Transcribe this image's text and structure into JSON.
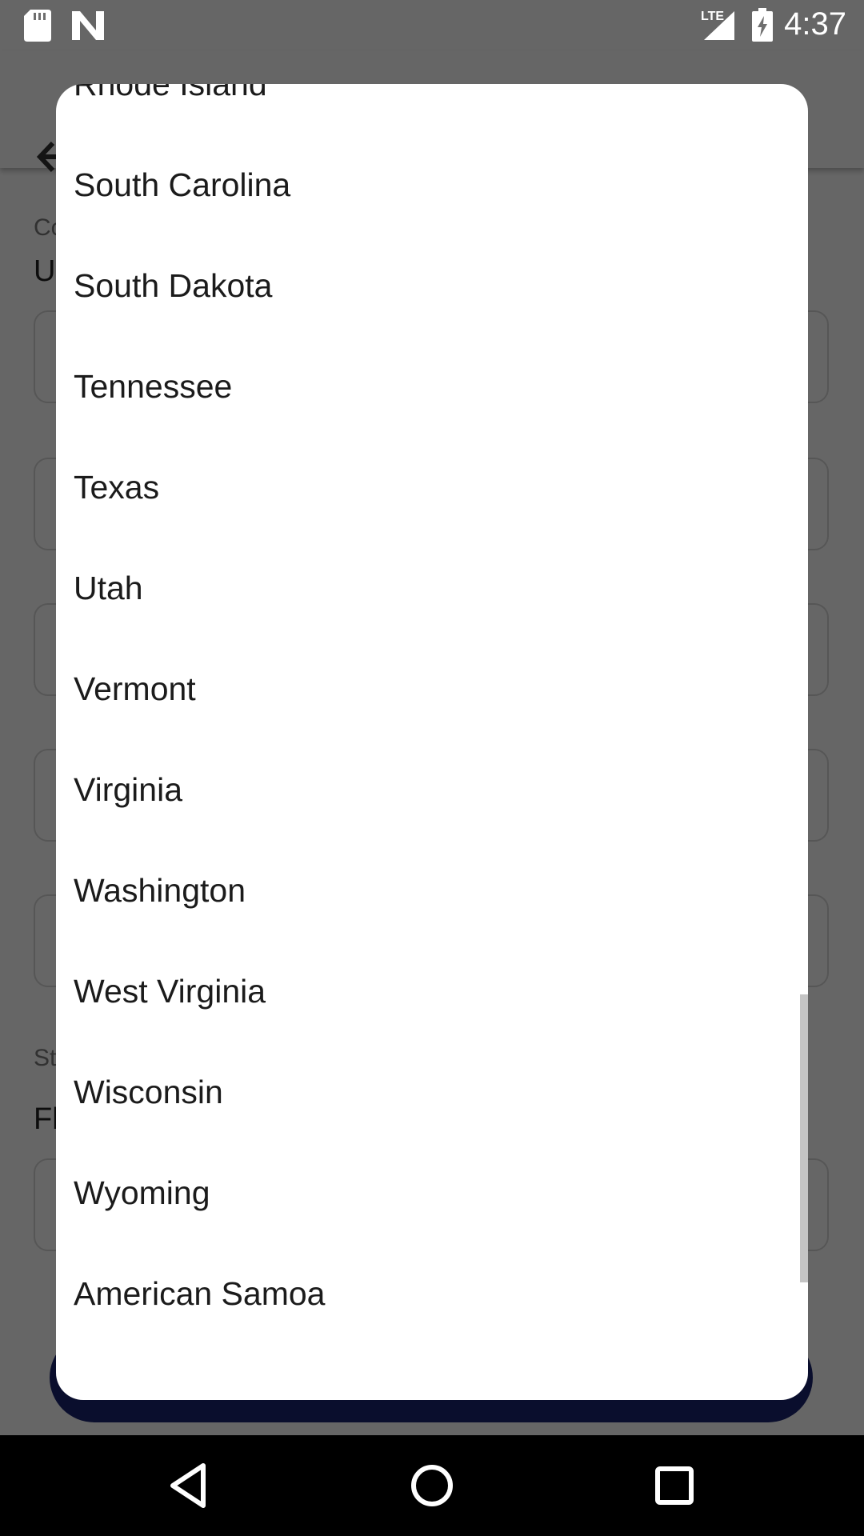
{
  "status_bar": {
    "time": "4:37",
    "network": "LTE",
    "icons": [
      "sd-card-icon",
      "n-notification-icon",
      "signal-icon",
      "battery-charging-icon"
    ]
  },
  "background_page": {
    "fields": [
      {
        "label": "Co",
        "value": "Ur"
      },
      {
        "label": "St",
        "value": "Fl"
      }
    ]
  },
  "state_picker": {
    "items": [
      "Rhode Island",
      "South Carolina",
      "South Dakota",
      "Tennessee",
      "Texas",
      "Utah",
      "Vermont",
      "Virginia",
      "Washington",
      "West Virginia",
      "Wisconsin",
      "Wyoming",
      "American Samoa"
    ]
  },
  "nav_bar": {
    "buttons": [
      "back-icon",
      "home-icon",
      "recents-icon"
    ]
  },
  "colors": {
    "scrim": "#000000",
    "dialog": "#ffffff",
    "primary_button": "#1a2570",
    "navbar": "#000000"
  }
}
